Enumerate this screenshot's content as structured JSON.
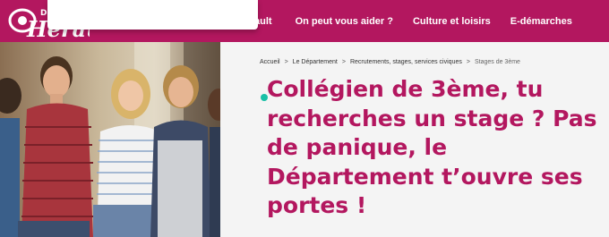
{
  "header": {
    "logo_small": "De",
    "logo_text": "Hérault",
    "nav": [
      {
        "label": "ault"
      },
      {
        "label": "On peut vous aider ?"
      },
      {
        "label": "Culture et loisirs"
      },
      {
        "label": "E-démarches"
      }
    ]
  },
  "breadcrumb": {
    "items": [
      "Accueil",
      "Le Département",
      "Recrutements, stages, services civiques",
      "Stages de 3ème"
    ],
    "separator": ">"
  },
  "page": {
    "title_lines": [
      "Collégien de 3ème, tu",
      "recherches un stage ? Pas",
      "de panique, le",
      "Département t’ouvre ses",
      "portes !"
    ]
  },
  "colors": {
    "brand": "#b3175f",
    "accent_dot": "#19c0a6"
  }
}
